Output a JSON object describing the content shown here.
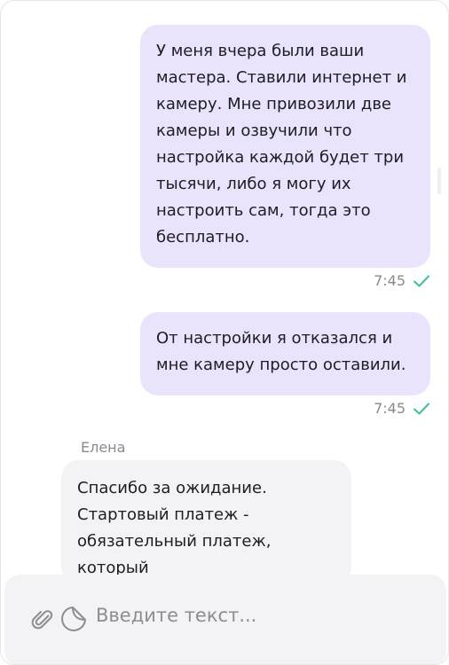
{
  "messages": {
    "out1": {
      "text": "У меня вчера были ваши мастера. Ставили интернет и камеру. Мне привозили две камеры и озвучили что настройка каждой будет три тысячи, либо я могу их настроить сам, тогда это бесплатно.",
      "time": "7:45",
      "status": "delivered"
    },
    "out2": {
      "text": "От настройки я отказался и мне камеру просто оставили.",
      "time": "7:45",
      "status": "delivered"
    },
    "in1": {
      "sender": "Елена",
      "text": "Спасибо за ожидание. Стартовый платеж - обязательный платеж, который"
    }
  },
  "composer": {
    "placeholder": "Введите текст...",
    "attach_icon": "paperclip-icon",
    "sticker_icon": "sticker-icon"
  },
  "colors": {
    "outgoing_bubble": "#e9e3fb",
    "incoming_bubble": "#f3f3f5",
    "check": "#3cc19a"
  }
}
